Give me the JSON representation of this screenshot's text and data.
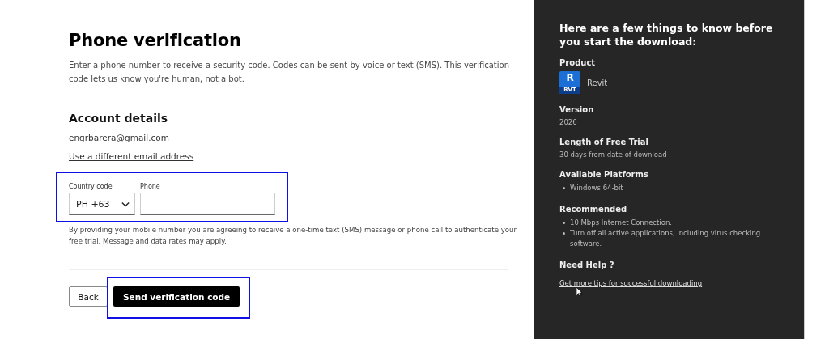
{
  "main": {
    "title": "Phone verification",
    "description": "Enter a phone number to receive a security code. Codes can be sent by voice or text (SMS). This verification code lets us know you're human, not a bot.",
    "account_heading": "Account details",
    "email": "engrbarera@gmail.com",
    "change_email_link": "Use a different email address",
    "country_code": {
      "label": "Country code",
      "value": "PH +63"
    },
    "phone": {
      "label": "Phone"
    },
    "disclaimer": "By providing your mobile number you are agreeing to receive a one-time text (SMS) message or phone call to authenticate your free trial. Message and data rates may apply.",
    "buttons": [
      {
        "label": "Back",
        "kind": "secondary"
      },
      {
        "label": "Send verification code",
        "kind": "primary"
      }
    ],
    "highlights": {
      "phone_fields": true,
      "send_button": true
    }
  },
  "sidebar": {
    "heading": "Here are a few things to know before you start the download:",
    "sections": [
      {
        "kind": "product",
        "title": "Product",
        "badge": "R",
        "badge_sub": "RVT",
        "value": "Revit"
      },
      {
        "kind": "text",
        "title": "Version",
        "value": "2026"
      },
      {
        "kind": "text",
        "title": "Length of Free Trial",
        "value": "30 days from date of download"
      },
      {
        "kind": "bullets",
        "title": "Available Platforms",
        "items": [
          "Windows 64-bit"
        ]
      },
      {
        "kind": "bullets",
        "title": "Recommended",
        "items": [
          "10 Mbps Internet Connection.",
          "Turn off all active applications, including virus checking software."
        ]
      },
      {
        "kind": "link",
        "title": "Need Help ?",
        "value": "Get more tips for successful downloading"
      }
    ]
  }
}
